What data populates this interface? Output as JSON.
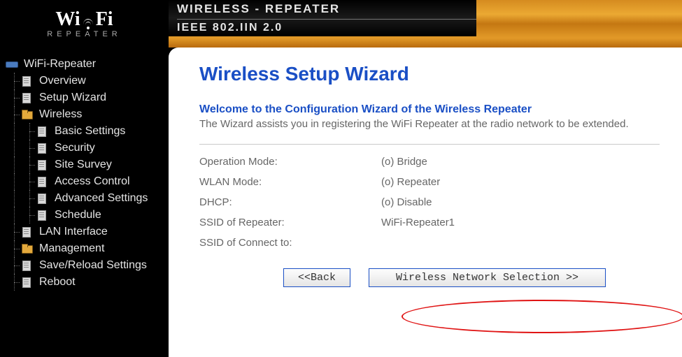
{
  "header": {
    "brand_top": "Wi",
    "brand_top2": "Fi",
    "brand_sub": "REPEATER",
    "line1": "WIRELESS - REPEATER",
    "line2": "IEEE 802.IIN 2.0"
  },
  "nav": {
    "root": "WiFi-Repeater",
    "items": [
      {
        "label": "Overview",
        "icon": "file"
      },
      {
        "label": "Setup Wizard",
        "icon": "file"
      },
      {
        "label": "Wireless",
        "icon": "folder",
        "children": [
          {
            "label": "Basic Settings"
          },
          {
            "label": "Security"
          },
          {
            "label": "Site Survey"
          },
          {
            "label": "Access Control"
          },
          {
            "label": "Advanced Settings"
          },
          {
            "label": "Schedule"
          }
        ]
      },
      {
        "label": "LAN Interface",
        "icon": "file"
      },
      {
        "label": "Management",
        "icon": "folder"
      },
      {
        "label": "Save/Reload Settings",
        "icon": "file"
      },
      {
        "label": "Reboot",
        "icon": "file"
      }
    ]
  },
  "main": {
    "title": "Wireless Setup Wizard",
    "welcome": "Welcome to the Configuration Wizard of the Wireless Repeater",
    "desc": "The Wizard assists you in registering the WiFi Repeater at the radio network to be extended.",
    "rows": [
      {
        "k": "Operation Mode:",
        "v": "(o) Bridge"
      },
      {
        "k": "WLAN Mode:",
        "v": "(o) Repeater"
      },
      {
        "k": "DHCP:",
        "v": "(o) Disable"
      },
      {
        "k": "SSID of Repeater:",
        "v": "WiFi-Repeater1"
      },
      {
        "k": "SSID of Connect to:",
        "v": ""
      }
    ],
    "back": "<<Back",
    "next": "Wireless Network Selection >>"
  }
}
